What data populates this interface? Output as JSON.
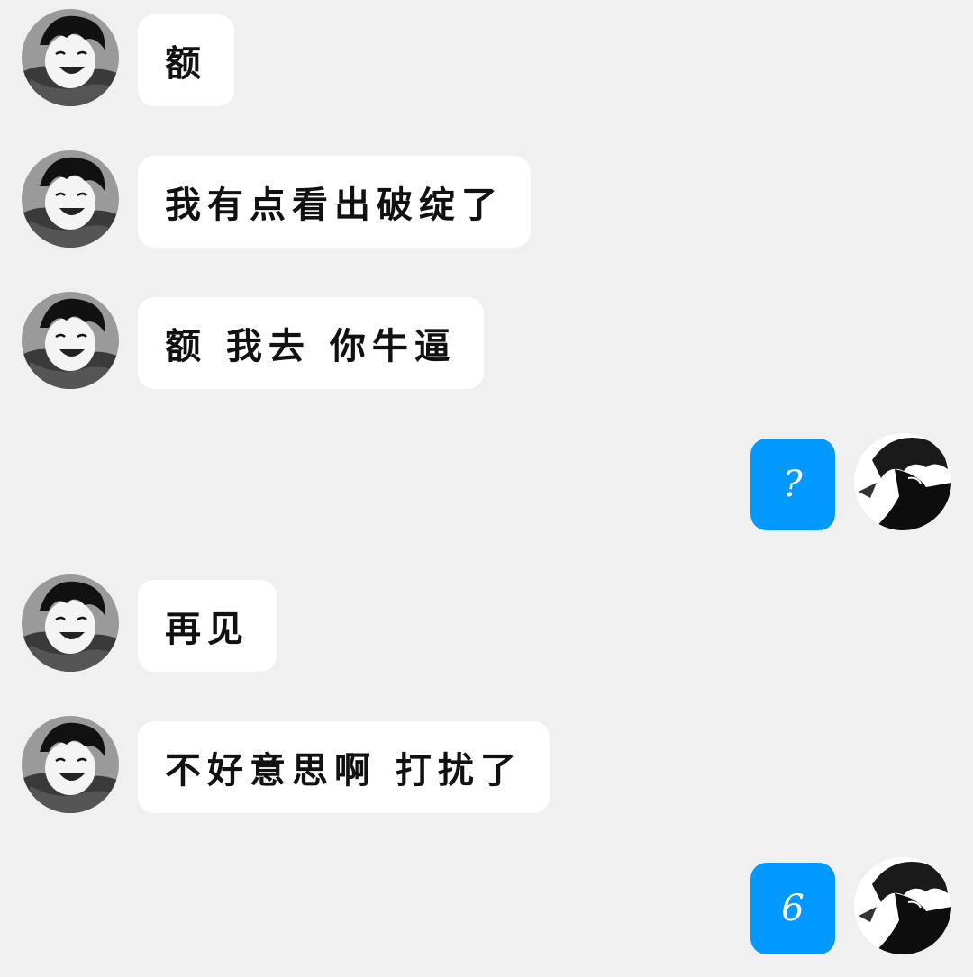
{
  "chat": {
    "messages": [
      {
        "side": "left",
        "text": "额"
      },
      {
        "side": "left",
        "text": "我有点看出破绽了"
      },
      {
        "side": "left",
        "text": "额 我去 你牛逼"
      },
      {
        "side": "right",
        "text": "?"
      },
      {
        "side": "left",
        "text": "再见"
      },
      {
        "side": "left",
        "text": "不好意思啊 打扰了"
      },
      {
        "side": "right",
        "text": "6"
      }
    ]
  },
  "colors": {
    "background": "#f0f0f0",
    "incoming_bubble": "#ffffff",
    "outgoing_bubble": "#0099ff",
    "incoming_text": "#111111",
    "outgoing_text": "#ffffff"
  },
  "icons": {
    "incoming_avatar": "avatar-monochrome-smiling-boy-with-scarf",
    "outgoing_avatar": "avatar-monochrome-dark-haired-figure"
  }
}
